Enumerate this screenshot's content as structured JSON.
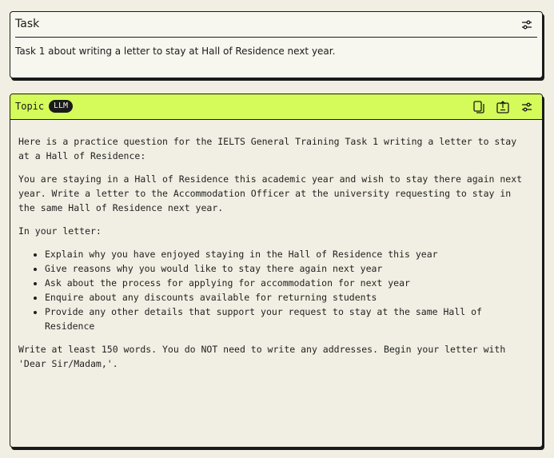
{
  "task": {
    "title": "Task",
    "body": "Task 1 about writing a letter to stay at Hall of Residence next year."
  },
  "topic": {
    "title": "Topic",
    "badge": "LLM",
    "intro": "Here is a practice question for the IELTS General Training Task 1 writing a letter to stay at a Hall of Residence:",
    "prompt": "You are staying in a Hall of Residence this academic year and wish to stay there again next year. Write a letter to the Accommodation Officer at the university requesting to stay in the same Hall of Residence next year.",
    "in_your_letter": "In your letter:",
    "bullets": [
      "Explain why you have enjoyed staying in the Hall of Residence this year",
      "Give reasons why you would like to stay there again next year",
      "Ask about the process for applying for accommodation for next year",
      "Enquire about any discounts available for returning students",
      "Provide any other details that support your request to stay at the same Hall of Residence"
    ],
    "closing": "Write at least 150 words. You do NOT need to write any addresses. Begin your letter with 'Dear Sir/Madam,'."
  },
  "icons": {
    "settings": "sliders-icon",
    "copy": "copy-icon",
    "share": "share-icon"
  },
  "colors": {
    "background": "#f1efe3",
    "topic_header": "#d4fb5a",
    "border": "#1a1a1a"
  }
}
